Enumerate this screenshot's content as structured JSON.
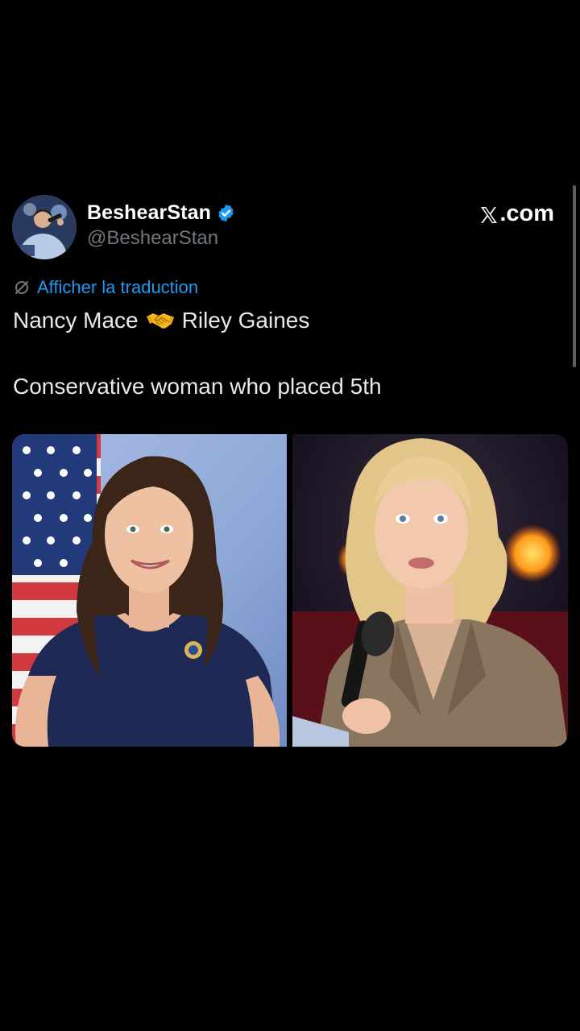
{
  "author": {
    "display_name": "BeshearStan",
    "handle": "@BeshearStan",
    "verified": true,
    "avatar": "user-avatar"
  },
  "brand": {
    "label": ".com",
    "icon": "x-logo-icon"
  },
  "translate": {
    "label": "Afficher la traduction",
    "icon": "translate-icon"
  },
  "tweet_text": {
    "line1_left": "Nancy Mace",
    "line1_emoji": "handshake-emoji",
    "line1_right": "Riley Gaines",
    "line2": "Conservative woman who placed 5th"
  },
  "media": {
    "photos": [
      {
        "name": "portrait-left-photo",
        "subject": "woman-in-navy-dress-with-flag"
      },
      {
        "name": "portrait-right-photo",
        "subject": "woman-with-microphone"
      }
    ]
  },
  "colors": {
    "background": "#000000",
    "text": "#e7e9ea",
    "secondary_text": "#71767b",
    "accent": "#1d9bf0",
    "verified_badge": "#1d9bf0"
  }
}
